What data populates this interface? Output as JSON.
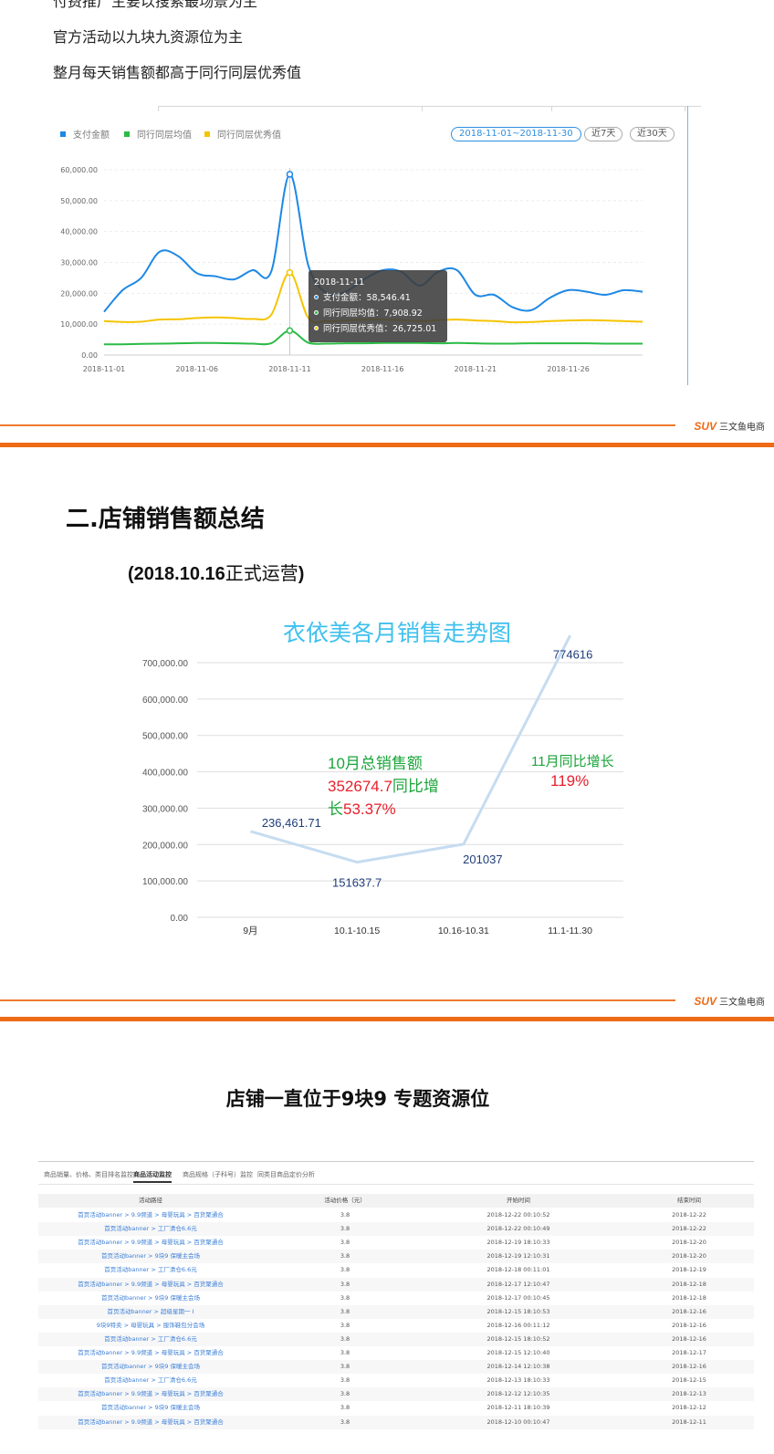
{
  "intro": {
    "line0": "付费推广主要以搜索最场景为主",
    "line1": "官方活动以九块九资源位为主",
    "line2": "整月每天销售额都高于同行同层优秀值"
  },
  "panel1": {
    "legend": [
      {
        "label": "支付金额",
        "color": "#1e88e5"
      },
      {
        "label": "同行同层均值",
        "color": "#2bbb45"
      },
      {
        "label": "同行同层优秀值",
        "color": "#f5c400"
      }
    ],
    "date_range": "2018-11-01~2018-11-30",
    "btn_7": "近7天",
    "btn_30": "近30天",
    "tooltip": {
      "date": "2018-11-11",
      "pay": "支付金额：58,546.41",
      "avg": "同行同层均值：7,908.92",
      "best": "同行同层优秀值：26,725.01"
    }
  },
  "chart_data": [
    {
      "type": "line",
      "x": [
        "2018-11-01",
        "2018-11-02",
        "2018-11-03",
        "2018-11-04",
        "2018-11-05",
        "2018-11-06",
        "2018-11-07",
        "2018-11-08",
        "2018-11-09",
        "2018-11-10",
        "2018-11-11",
        "2018-11-12",
        "2018-11-13",
        "2018-11-14",
        "2018-11-15",
        "2018-11-16",
        "2018-11-17",
        "2018-11-18",
        "2018-11-19",
        "2018-11-20",
        "2018-11-21",
        "2018-11-22",
        "2018-11-23",
        "2018-11-24",
        "2018-11-25",
        "2018-11-26",
        "2018-11-27",
        "2018-11-28",
        "2018-11-29",
        "2018-11-30"
      ],
      "x_tick_labels": [
        "2018-11-01",
        "2018-11-06",
        "2018-11-11",
        "2018-11-16",
        "2018-11-21",
        "2018-11-26"
      ],
      "y_tick_labels": [
        "0.00",
        "10,000.00",
        "20,000.00",
        "30,000.00",
        "40,000.00",
        "50,000.00",
        "60,000.00"
      ],
      "ylim": [
        0,
        60000
      ],
      "legend_position": "top-left",
      "grid": true,
      "series": [
        {
          "name": "支付金额",
          "color": "#1e88e5",
          "values": [
            14000,
            21000,
            25000,
            33500,
            32000,
            26500,
            25500,
            24500,
            27500,
            27000,
            58546.41,
            29000,
            20000,
            20500,
            24500,
            27500,
            27000,
            22500,
            27000,
            27500,
            19500,
            19500,
            15500,
            14500,
            18500,
            21000,
            20500,
            19500,
            21000,
            20500
          ]
        },
        {
          "name": "同行同层均值",
          "color": "#2bbb45",
          "values": [
            3500,
            3500,
            3600,
            3700,
            3800,
            3900,
            3900,
            3800,
            3700,
            3800,
            7908.92,
            4000,
            3700,
            3800,
            3800,
            3900,
            3900,
            3900,
            3800,
            3900,
            3800,
            3700,
            3700,
            3800,
            3800,
            3800,
            3800,
            3700,
            3700,
            3700
          ]
        },
        {
          "name": "同行同层优秀值",
          "color": "#f5c400",
          "values": [
            11000,
            10700,
            10800,
            11500,
            11600,
            12000,
            12200,
            12000,
            11700,
            13000,
            26725.01,
            12000,
            11000,
            11200,
            11500,
            11500,
            11300,
            11000,
            11300,
            11500,
            11200,
            11000,
            10600,
            10700,
            11000,
            11200,
            11300,
            11200,
            11000,
            10800
          ]
        }
      ]
    },
    {
      "type": "line",
      "title": "衣依美各月销售走势图",
      "categories": [
        "9月",
        "10.1-10.15",
        "10.16-10.31",
        "11.1-11.30"
      ],
      "values": [
        236461.71,
        151637.7,
        201037,
        774616
      ],
      "data_labels": [
        "236,461.71",
        "151637.7",
        "201037",
        "774616"
      ],
      "y_tick_labels": [
        "0.00",
        "100,000.00",
        "200,000.00",
        "300,000.00",
        "400,000.00",
        "500,000.00",
        "600,000.00",
        "700,000.00"
      ],
      "ylim": [
        0,
        700000
      ],
      "grid": true,
      "color": "#c6dcf0"
    }
  ],
  "section2": {
    "title": "二.店铺销售额总结",
    "sub_paren_open": "(2018.10.16",
    "sub_zh": "正式运营",
    "sub_paren_close": ")",
    "anno_oct_line1": "10月总销售额",
    "anno_oct_value": "352674.7",
    "anno_oct_text2": "同比增",
    "anno_oct_text3": "长",
    "anno_oct_pct": "53.37%",
    "anno_nov_label": "11月同比增长",
    "anno_nov_pct": "119%"
  },
  "brand": {
    "logo": "SUV",
    "name": "三文鱼电商"
  },
  "table_section": {
    "title": "店铺一直位于9块9 专题资源位",
    "tabs": [
      "商品销量、价格、类目排名监控",
      "商品活动监控",
      "商品规格（子科号）监控",
      "同类目商品定价分析"
    ],
    "headers": [
      "活动路径",
      "活动价格（元）",
      "开始时间",
      "结束时间"
    ],
    "rows": [
      [
        "首页活动banner > 9.9频道 > 母婴玩具 > 百货聚通合",
        "3.8",
        "2018-12-22 00:10:52",
        "2018-12-22"
      ],
      [
        "首页活动banner > 工厂清仓6.6元",
        "3.8",
        "2018-12-22 00:10:49",
        "2018-12-22"
      ],
      [
        "首页活动banner > 9.9频道 > 母婴玩具 > 百货聚通合",
        "3.8",
        "2018-12-19 18:10:33",
        "2018-12-20"
      ],
      [
        "首页活动banner > 9块9 保暖主会场",
        "3.8",
        "2018-12-19 12:10:31",
        "2018-12-20"
      ],
      [
        "首页活动banner > 工厂清仓6.6元",
        "3.8",
        "2018-12-18 00:11:01",
        "2018-12-19"
      ],
      [
        "首页活动banner > 9.9频道 > 母婴玩具 > 百货聚通合",
        "3.8",
        "2018-12-17 12:10:47",
        "2018-12-18"
      ],
      [
        "首页活动banner > 9块9 保暖主会场",
        "3.8",
        "2018-12-17 00:10:45",
        "2018-12-18"
      ],
      [
        "首页活动banner > 超级星期一 I",
        "3.8",
        "2018-12-15 18:10:53",
        "2018-12-16"
      ],
      [
        "9块9特卖 > 母婴玩具 > 服饰鞋包分会场",
        "3.8",
        "2018-12-16 00:11:12",
        "2018-12-16"
      ],
      [
        "首页活动banner > 工厂清仓6.6元",
        "3.8",
        "2018-12-15 18:10:52",
        "2018-12-16"
      ],
      [
        "首页活动banner > 9.9频道 > 母婴玩具 > 百货聚通合",
        "3.8",
        "2018-12-15 12:10:40",
        "2018-12-17"
      ],
      [
        "首页活动banner > 9块9 保暖主会场",
        "3.8",
        "2018-12-14 12:10:38",
        "2018-12-16"
      ],
      [
        "首页活动banner > 工厂清仓6.6元",
        "3.8",
        "2018-12-13 18:10:33",
        "2018-12-15"
      ],
      [
        "首页活动banner > 9.9频道 > 母婴玩具 > 百货聚通合",
        "3.8",
        "2018-12-12 12:10:35",
        "2018-12-13"
      ],
      [
        "首页活动banner > 9块9 保暖主会场",
        "3.8",
        "2018-12-11 18:10:39",
        "2018-12-12"
      ],
      [
        "首页活动banner > 9.9频道 > 母婴玩具 > 百货聚通合",
        "3.8",
        "2018-12-10 00:10:47",
        "2018-12-11"
      ]
    ]
  }
}
